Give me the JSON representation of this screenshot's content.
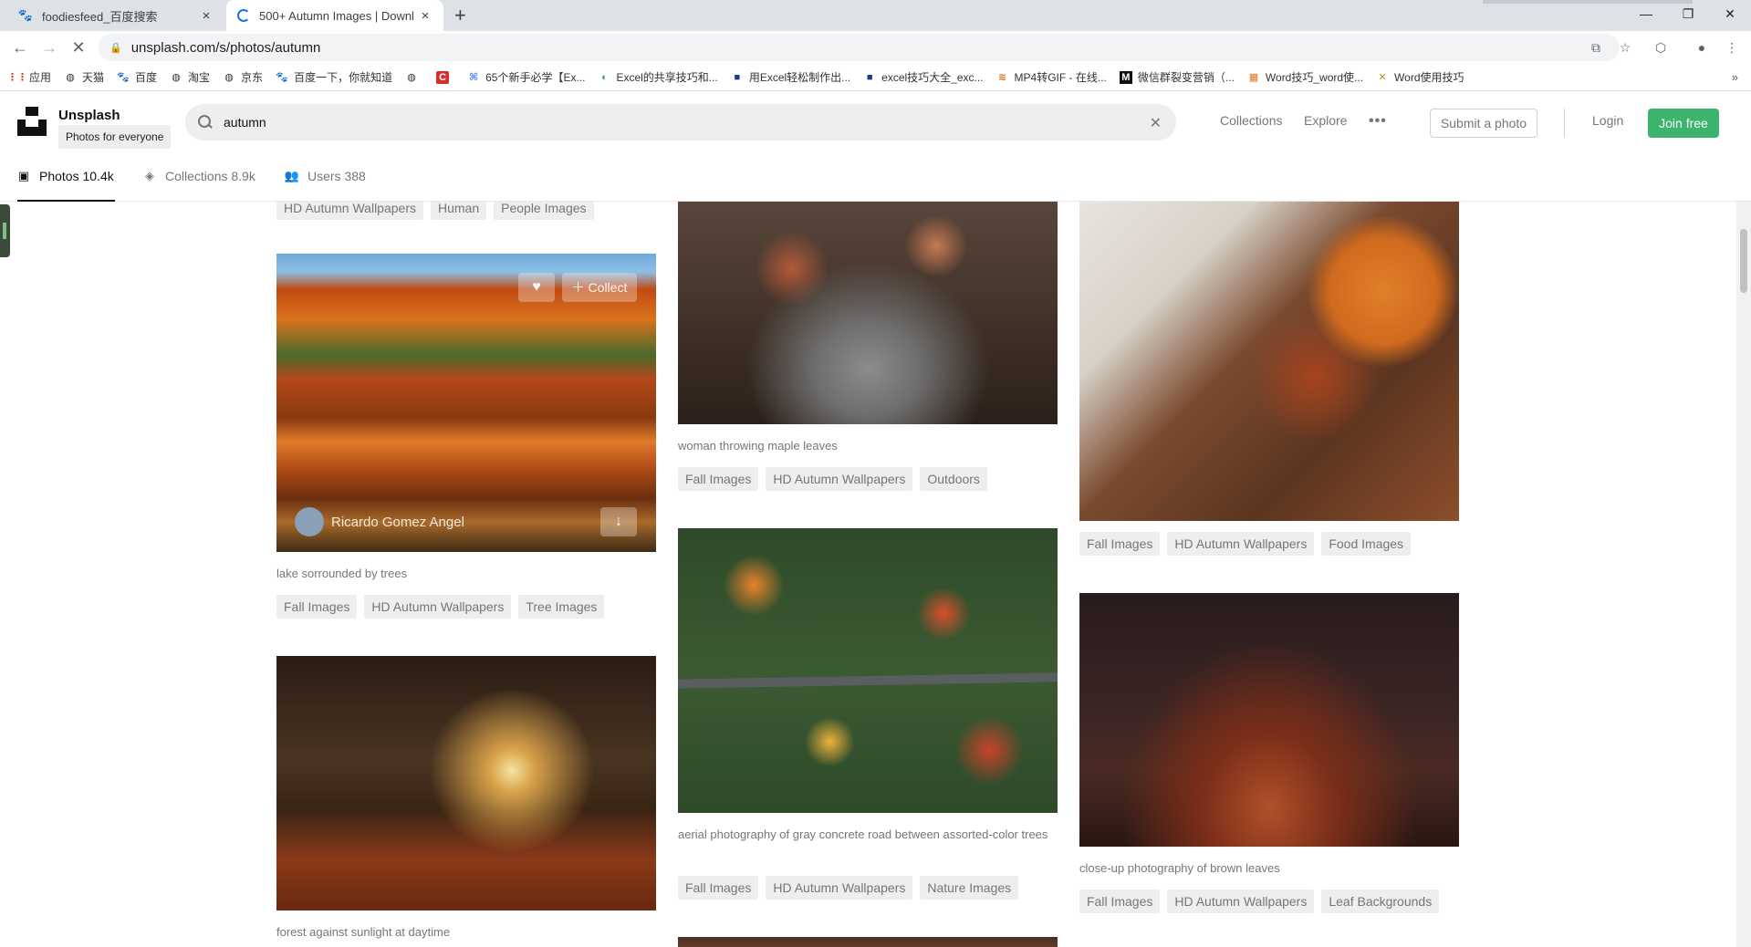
{
  "browser": {
    "tabs": [
      {
        "title": "foodiesfeed_百度搜索",
        "active": false
      },
      {
        "title": "500+ Autumn Images | Downl",
        "active": true
      }
    ],
    "url": "unsplash.com/s/photos/autumn",
    "bookmarks": [
      {
        "label": "应用",
        "icon": "apps-icon"
      },
      {
        "label": "天猫",
        "icon": "globe-icon"
      },
      {
        "label": "百度",
        "icon": "baidu-icon"
      },
      {
        "label": "淘宝",
        "icon": "globe-icon"
      },
      {
        "label": "京东",
        "icon": "globe-icon"
      },
      {
        "label": "百度一下，你就知道",
        "icon": "baidu-icon"
      },
      {
        "label": "",
        "icon": "globe-icon"
      },
      {
        "label": "",
        "icon": "c-icon"
      },
      {
        "label": "65个新手必学【Ex...",
        "icon": "doc-icon"
      },
      {
        "label": "Excel的共享技巧和...",
        "icon": "edge-icon"
      },
      {
        "label": "用Excel轻松制作出...",
        "icon": "bookmark-icon"
      },
      {
        "label": "excel技巧大全_exc...",
        "icon": "bookmark-icon"
      },
      {
        "label": "MP4转GIF - 在线...",
        "icon": "convert-icon"
      },
      {
        "label": "微信群裂变营销（...",
        "icon": "m-icon"
      },
      {
        "label": "Word技巧_word使...",
        "icon": "grid-icon"
      },
      {
        "label": "Word使用技巧",
        "icon": "x-icon"
      }
    ]
  },
  "header": {
    "brand_name": "Unsplash",
    "brand_tagline": "Photos for everyone",
    "search_value": "autumn",
    "nav_collections": "Collections",
    "nav_explore": "Explore",
    "submit_label": "Submit a photo",
    "login_label": "Login",
    "join_label": "Join free"
  },
  "subnav": {
    "photos": "Photos 10.4k",
    "collections": "Collections 8.9k",
    "users": "Users 388"
  },
  "columns": {
    "col1": {
      "top_tags": [
        "HD Autumn Wallpapers",
        "Human",
        "People Images"
      ],
      "photo1": {
        "caption": "lake sorrounded by trees",
        "tags": [
          "Fall Images",
          "HD Autumn Wallpapers",
          "Tree Images"
        ],
        "author": "Ricardo Gomez Angel",
        "collect_label": "Collect"
      },
      "photo2": {
        "caption": "forest against sunlight at daytime"
      }
    },
    "col2": {
      "photo1": {
        "caption": "woman throwing maple leaves",
        "tags": [
          "Fall Images",
          "HD Autumn Wallpapers",
          "Outdoors"
        ]
      },
      "photo2": {
        "caption": "aerial photography of gray concrete road between assorted-color trees",
        "tags": [
          "Fall Images",
          "HD Autumn Wallpapers",
          "Nature Images"
        ]
      }
    },
    "col3": {
      "photo1": {
        "tags": [
          "Fall Images",
          "HD Autumn Wallpapers",
          "Food Images"
        ]
      },
      "photo2": {
        "caption": "close-up photography of brown leaves",
        "tags": [
          "Fall Images",
          "HD Autumn Wallpapers",
          "Leaf Backgrounds"
        ]
      }
    }
  },
  "colors": {
    "accent_green": "#3cb46e",
    "tag_bg": "#eeeeee",
    "muted_text": "#767676"
  }
}
